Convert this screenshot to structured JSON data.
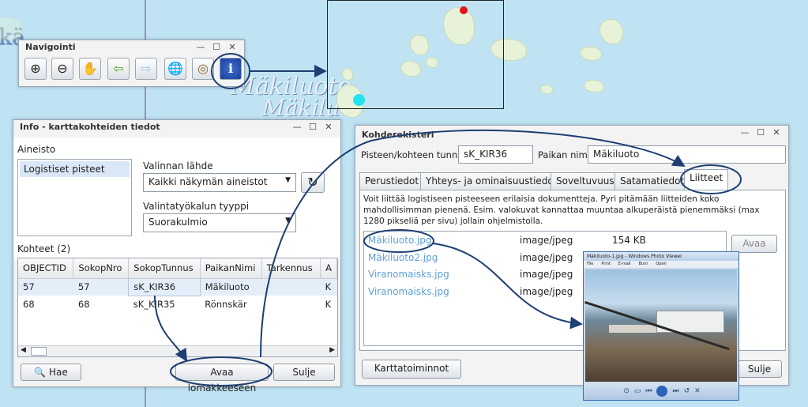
{
  "map": {
    "labels": [
      "Mäkiluoto",
      "Mäkilu",
      "kä"
    ]
  },
  "navigation": {
    "title": "Navigointi",
    "tools": [
      "zoom-in-icon",
      "zoom-out-icon",
      "pan-hand-icon",
      "back-arrow-icon",
      "forward-arrow-icon",
      "globe-icon",
      "target-icon",
      "info-icon"
    ]
  },
  "info_panel": {
    "title": "Info - karttakohteiden tiedot",
    "dataset_label": "Aineisto",
    "dataset_item": "Logistiset pisteet",
    "source_label": "Valinnan lähde",
    "source_value": "Kaikki näkymän aineistot",
    "tool_label": "Valintatyökalun tyyppi",
    "tool_value": "Suorakulmio",
    "objects_label": "Kohteet  (2)",
    "columns": [
      "OBJECTID",
      "SokopNro",
      "SokopTunnus",
      "PaikanNimi",
      "Tarkennus",
      "A"
    ],
    "rows": [
      [
        "57",
        "57",
        "sK_KIR36",
        "Mäkiluoto",
        "",
        "K"
      ],
      [
        "68",
        "68",
        "sK_KIR35",
        "Rönnskär",
        "",
        "K"
      ]
    ],
    "search_button": "Hae",
    "open_form_button": "Avaa lomakkeeseen",
    "close_button": "Sulje"
  },
  "register_panel": {
    "title": "Kohderekisteri",
    "point_id_label": "Pisteen/kohteen tunnus",
    "point_id_value": "sK_KIR36",
    "place_label": "Paikan nimi",
    "place_value": "Mäkiluoto",
    "tabs": [
      "Perustiedot",
      "Yhteys- ja ominaisuustiedot",
      "Soveltuvuus",
      "Satamatiedot",
      "Liitteet"
    ],
    "active_tab": "Liitteet",
    "description": "Voit liittää logistiseen pisteeseen erilaisia dokumentteja. Pyri pitämään liitteiden koko mahdollisimman pienenä. Esim. valokuvat kannattaa muuntaa alkuperäistä pienemmäksi (max 1280 pikseliä per sivu) jollain ohjelmistolla.",
    "files": [
      {
        "name": "Mäkiluoto.jpg",
        "type": "image/jpeg",
        "size": "154 KB"
      },
      {
        "name": "Mäkiluoto2.jpg",
        "type": "image/jpeg",
        "size": ""
      },
      {
        "name": "Viranomaisks.jpg",
        "type": "image/jpeg",
        "size": ""
      },
      {
        "name": "Viranomaisks.jpg",
        "type": "image/jpeg",
        "size": ""
      }
    ],
    "open_button": "Avaa",
    "map_functions_button": "Karttatoiminnot",
    "close_button": "Sulje"
  },
  "photo_viewer": {
    "title": "Mäkiluoto-1.jpg - Windows Photo Viewer",
    "menu": [
      "File",
      "Print",
      "E-mail",
      "Burn",
      "Open"
    ]
  },
  "colors": {
    "accent": "#1d3f73",
    "link": "#5f9fd6",
    "redpoint": "#e0141a",
    "cyanpoint": "#21e3f0"
  }
}
